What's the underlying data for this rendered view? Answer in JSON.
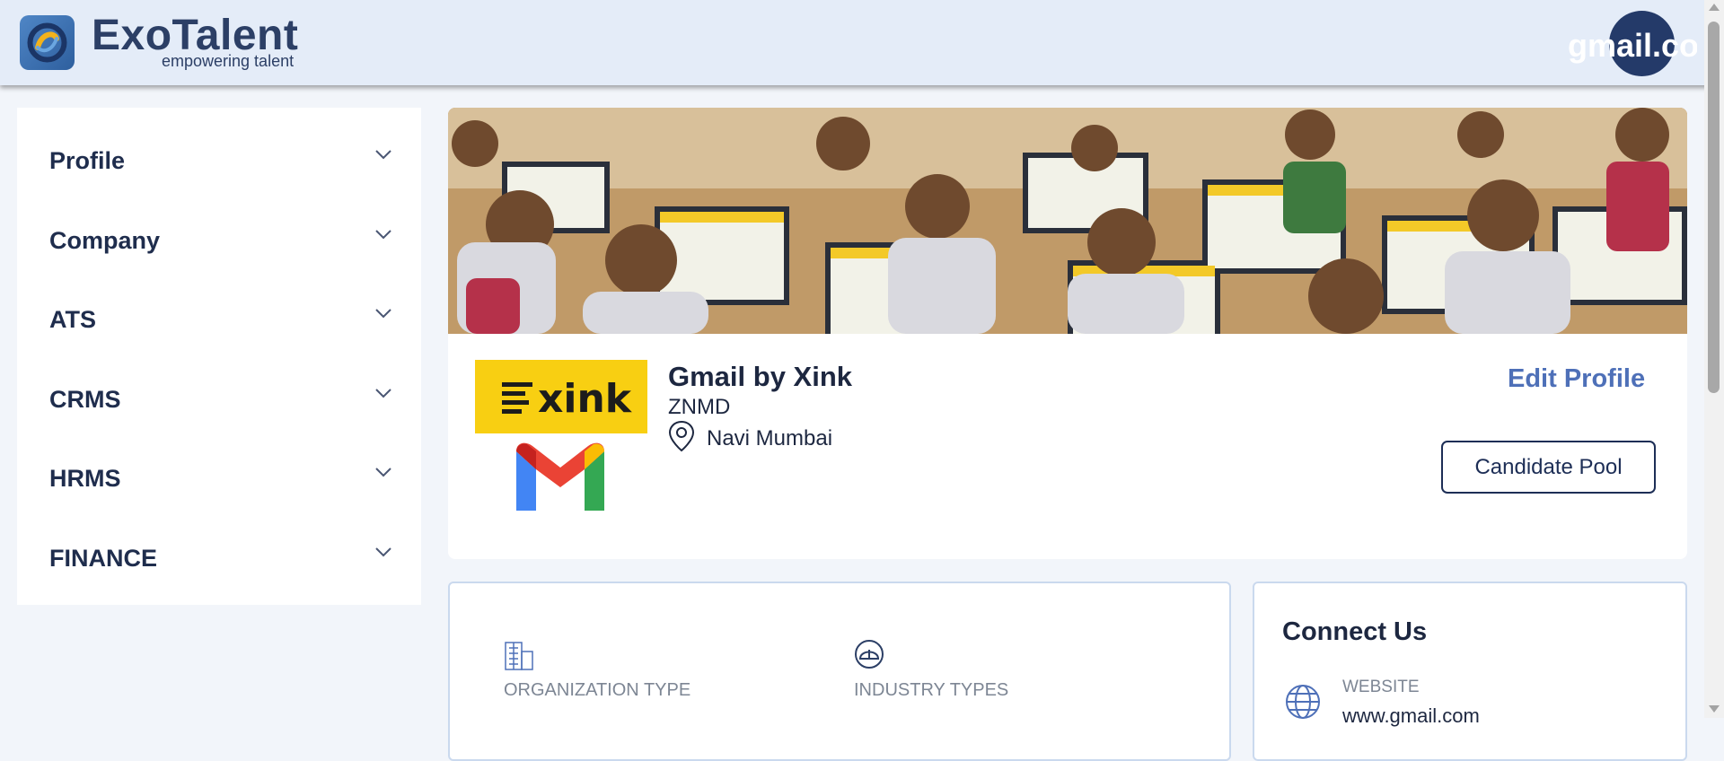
{
  "header": {
    "brand_name": "ExoTalent",
    "brand_tagline": "empowering talent",
    "user_label": "gmail.com"
  },
  "sidebar": {
    "items": [
      {
        "label": "Profile"
      },
      {
        "label": "Company"
      },
      {
        "label": "ATS"
      },
      {
        "label": "CRMS"
      },
      {
        "label": "HRMS"
      },
      {
        "label": "FINANCE"
      }
    ]
  },
  "profile": {
    "logo_text": "xink",
    "company_name": "Gmail by Xink",
    "company_subtitle": "ZNMD",
    "location": "Navi Mumbai",
    "edit_label": "Edit Profile",
    "candidate_pool_label": "Candidate Pool"
  },
  "details": {
    "organization_type_label": "ORGANIZATION TYPE",
    "industry_types_label": "INDUSTRY TYPES"
  },
  "connect": {
    "title": "Connect Us",
    "website_label": "WEBSITE",
    "website_value": "www.gmail.com"
  },
  "colors": {
    "header_bg": "#e4ecf8",
    "navy": "#1d2e56",
    "link_blue": "#4e70b8",
    "xink_yellow": "#f8cf12"
  },
  "icons": [
    "app-logo-icon",
    "chevron-down-icon",
    "location-pin-icon",
    "gmail-icon",
    "building-icon",
    "helmet-icon",
    "globe-icon"
  ]
}
